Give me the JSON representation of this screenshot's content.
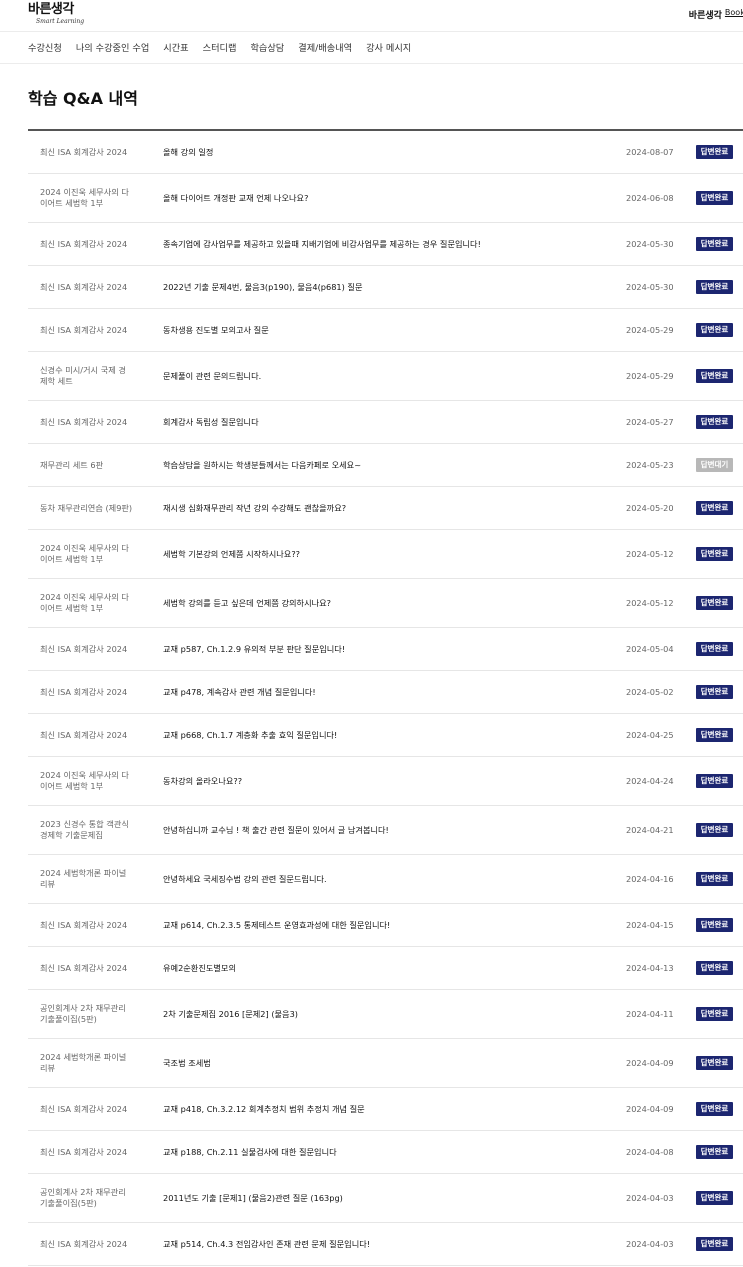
{
  "header": {
    "logo_main": "바른생각",
    "logo_sub": "Smart Learning",
    "right_label": "바른생각",
    "books_link": "Books"
  },
  "nav": [
    {
      "label": "수강신청"
    },
    {
      "label": "나의 수강중인 수업"
    },
    {
      "label": "시간표"
    },
    {
      "label": "스터디랩"
    },
    {
      "label": "학습상담"
    },
    {
      "label": "결제/배송내역"
    },
    {
      "label": "강사 메시지"
    }
  ],
  "page_title": "학습 Q&A 내역",
  "qna_rows": [
    {
      "course": "최신 ISA 회계감사 2024",
      "subject": "올해 강의 일정",
      "date": "2024-08-07",
      "status": "답변완료"
    },
    {
      "course": "2024 이진욱 세무사의 다이어트 세법학 1부",
      "subject": "올해 다이어트 개정판 교재 언제 나오나요?",
      "date": "2024-06-08",
      "status": "답변완료"
    },
    {
      "course": "최신 ISA 회계감사 2024",
      "subject": "종속기업에 감사업무를 제공하고 있을때 지배기업에 비감사업무를 제공하는 경우 질문입니다!",
      "date": "2024-05-30",
      "status": "답변완료"
    },
    {
      "course": "최신 ISA 회계감사 2024",
      "subject": "2022년 기출 문제4번, 물음3(p190), 물음4(p681) 질문",
      "date": "2024-05-30",
      "status": "답변완료"
    },
    {
      "course": "최신 ISA 회계감사 2024",
      "subject": "동차생용 진도별 모의고사 질문",
      "date": "2024-05-29",
      "status": "답변완료"
    },
    {
      "course": "신경수 미시/거시 국제 경제학 세트",
      "subject": "문제풀이 관련 문의드립니다.",
      "date": "2024-05-29",
      "status": "답변완료"
    },
    {
      "course": "최신 ISA 회계감사 2024",
      "subject": "회계감사 독립성 질문입니다",
      "date": "2024-05-27",
      "status": "답변완료"
    },
    {
      "course": "재무관리 세트 6판",
      "subject": "학습상담을 원하시는 학생분들께서는 다음카페로 오세요~",
      "date": "2024-05-23",
      "status": "답변대기"
    },
    {
      "course": "동차 재무관리연습 (제9판)",
      "subject": "재시생 심화재무관리 작년 강의 수강해도 괜찮을까요?",
      "date": "2024-05-20",
      "status": "답변완료"
    },
    {
      "course": "2024 이진욱 세무사의 다이어트 세법학 1부",
      "subject": "세법학 기본강의 언제쯤 시작하시나요??",
      "date": "2024-05-12",
      "status": "답변완료"
    },
    {
      "course": "2024 이진욱 세무사의 다이어트 세법학 1부",
      "subject": "세법학 강의를 듣고 싶은데 언제쯤 강의하시나요?",
      "date": "2024-05-12",
      "status": "답변완료"
    },
    {
      "course": "최신 ISA 회계감사 2024",
      "subject": "교재 p587, Ch.1.2.9 유의적 부분 판단 질문입니다!",
      "date": "2024-05-04",
      "status": "답변완료"
    },
    {
      "course": "최신 ISA 회계감사 2024",
      "subject": "교재 p478, 계속감사 관련 개념 질문입니다!",
      "date": "2024-05-02",
      "status": "답변완료"
    },
    {
      "course": "최신 ISA 회계감사 2024",
      "subject": "교재 p668, Ch.1.7 계층화 추출 효익 질문입니다!",
      "date": "2024-04-25",
      "status": "답변완료"
    },
    {
      "course": "2024 이진욱 세무사의 다이어트 세법학 1부",
      "subject": "동차강의 올라오나요??",
      "date": "2024-04-24",
      "status": "답변완료"
    },
    {
      "course": "2023 신경수 통합 객관식 경제학 기출문제집",
      "subject": "안녕하십니까 교수님 ! 책 출간 관련 질문이 있어서 글 남겨봅니다!",
      "date": "2024-04-21",
      "status": "답변완료"
    },
    {
      "course": "2024 세법학개론 파이널리뷰",
      "subject": "안녕하세요 국세징수법 강의 관련 질문드립니다.",
      "date": "2024-04-16",
      "status": "답변완료"
    },
    {
      "course": "최신 ISA 회계감사 2024",
      "subject": "교재 p614, Ch.2.3.5 통제테스트 운영효과성에 대한 질문입니다!",
      "date": "2024-04-15",
      "status": "답변완료"
    },
    {
      "course": "최신 ISA 회계감사 2024",
      "subject": "유예2순환진도별모의",
      "date": "2024-04-13",
      "status": "답변완료"
    },
    {
      "course": "공인회계사 2차 재무관리 기출풀이집(5판)",
      "subject": "2차 기출문제집 2016 [문제2] (물음3)",
      "date": "2024-04-11",
      "status": "답변완료"
    },
    {
      "course": "2024 세법학개론 파이널리뷰",
      "subject": "국조법 조세법",
      "date": "2024-04-09",
      "status": "답변완료"
    },
    {
      "course": "최신 ISA 회계감사 2024",
      "subject": "교재 p418, Ch.3.2.12 회계추정치 범위 추정치 개념 질문",
      "date": "2024-04-09",
      "status": "답변완료"
    },
    {
      "course": "최신 ISA 회계감사 2024",
      "subject": "교재 p188, Ch.2.11 실물검사에 대한 질문입니다",
      "date": "2024-04-08",
      "status": "답변완료"
    },
    {
      "course": "공인회계사 2차 재무관리 기출풀이집(5판)",
      "subject": "2011년도 기출 [문제1] (물음2)관련 질문 (163pg)",
      "date": "2024-04-03",
      "status": "답변완료"
    },
    {
      "course": "최신 ISA 회계감사 2024",
      "subject": "교재 p514, Ch.4.3 전임감사인 존재 관련 문제 질문입니다!",
      "date": "2024-04-03",
      "status": "답변완료"
    }
  ],
  "colors": {
    "badge_done": "#1c2670",
    "badge_waiting": "#b8b8b8"
  }
}
